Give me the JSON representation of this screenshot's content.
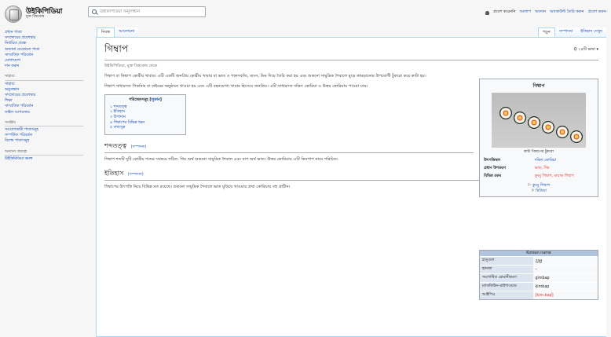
{
  "logo": {
    "title": "উইকিপিডিয়া",
    "subtitle": "মুক্ত বিশ্বকোষ"
  },
  "search": {
    "placeholder": "উইকিপিডিয়া অনুসন্ধান"
  },
  "personal": [
    "প্রবেশ করেননি",
    "আলাপ",
    "অবদান",
    "অ্যাকাউন্ট তৈরি করুন",
    "প্রবেশ করুন"
  ],
  "sidebar": {
    "groups": [
      {
        "heading": "",
        "items": [
          "প্রধান পাতা",
          "সম্প্রদায়ের প্রবেশদ্বার",
          "নির্বাচিত প্রবন্ধ",
          "অজানা যেকোনো পাতা",
          "সাম্প্রতিক পরিবর্তন",
          "যোগাযোগ",
          "দান করুন"
        ]
      },
      {
        "heading": "সাহায্য",
        "items": [
          "সাহায্য",
          "অনুসন্ধান",
          "সম্প্রদায়ের প্রবেশদ্বার",
          "শিক্ষা",
          "সাম্প্রতিক পরিবর্তন",
          "ফাইল আপলোড"
        ]
      },
      {
        "heading": "সরঞ্জাম",
        "items": [
          "সংযোগকারী পাতাসমূহ",
          "সম্পর্কিত পরিবর্তন",
          "বিশেষ পাতাসমূহ"
        ]
      },
      {
        "heading": "অন্যান্য প্রকল্পে",
        "items": [
          "উইকিমিডিয়া কমন্স"
        ]
      }
    ]
  },
  "tabs": {
    "article": "নিবন্ধ",
    "talk": "আলোচনা",
    "read": "পড়ুন",
    "edit": "সম্পাদনা",
    "history": "ইতিহাস দেখুন"
  },
  "page": {
    "title": "গিম্বাপ",
    "lang_label": "২৫টি ভাষা",
    "tagline": "উইকিপিডিয়া, মুক্ত বিশ্বকোষ থেকে",
    "intro1": "গিম্বাপ বা কিম্বাপ কোরীয় খাবার। এটি একটি জনপ্রিয় কোরীয় খাবার যা ভাত ও শাকসবজি, মাংস, ডিম দিয়ে তৈরি করা হয় এবং শুকনো সামুদ্রিক শৈবালে মুড়ে কামড়ানোর উপযোগী টুকরো করে কাটা হয়।",
    "intro2": "গিম্বাপ সাধারণত পিকনিক বা বাইরের অনুষ্ঠানে খাওয়া হয় এবং এটি বহনযোগ্য খাবার হিসেবে জনপ্রিয়। এটি সাধারণত দক্ষিণ কোরিয়া ও উত্তর কোরিয়ায় পাওয়া যায়।",
    "etymology_heading": "শব্দতত্ত্ব",
    "etymology_text": "গিম্বাপ শব্দটি দুটি কোরীয় শব্দের সমন্বয়ে গঠিত: গিম অর্থ শুকনো সামুদ্রিক শৈবাল এবং বাপ অর্থ ভাত। উত্তর কোরিয়ায় এটি কিমপাপ নামে পরিচিত।",
    "history_heading": "ইতিহাস",
    "history_text": "গিম্বাপের উৎপত্তি নিয়ে বিভিন্ন মত রয়েছে। শুকনো সামুদ্রিক শৈবালে ভাত মুড়িয়ে খাওয়ার প্রথা কোরিয়ায় বহু প্রাচীন।",
    "edit_label": "সম্পাদনা"
  },
  "toc": {
    "heading": "পরিচ্ছেদসমূহ",
    "toggle": "লুকান",
    "items": [
      "১ শব্দতত্ত্ব",
      "২ ইতিহাস",
      "৩ উপাদান",
      "৪ গিম্বাপের বিভিন্ন ধরন",
      "৫ তথ্যসূত্র"
    ]
  },
  "infobox": {
    "title": "গিম্বাপ",
    "caption": "কাটা গিম্বাপের টুকরো",
    "rows": [
      {
        "k": "উৎপত্তিস্থল",
        "v": "দক্ষিণ কোরিয়া"
      },
      {
        "k": "প্রধান উপকরণ",
        "v": "ভাত, গিম"
      },
      {
        "k": "বিভিন্ন রকম",
        "v": "কুংমু গিম্বাপ, মায়াক গিম্বাপ"
      }
    ],
    "related": [
      "কুংমু গিম্বাপ",
      "মিডিয়া"
    ]
  },
  "korean": {
    "heading": "Korean name",
    "rows": [
      {
        "k": "হাঙ্গুল",
        "v": "김밥"
      },
      {
        "k": "হানজা",
        "v": "–"
      },
      {
        "k": "সংশোধিত রোমানীকরণ",
        "v": "gimbap"
      },
      {
        "k": "ম্যাককিউন–রাইশাওয়ার",
        "v": "kimbap"
      },
      {
        "k": "আইপিএ",
        "v": "[kim.bap̚]"
      }
    ]
  },
  "colors": {
    "link": "#0645ad",
    "redlink": "#d33",
    "border": "#a7d7f9"
  }
}
